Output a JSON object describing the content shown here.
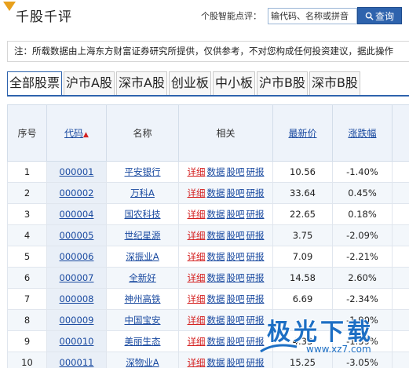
{
  "header": {
    "title": "千股千评",
    "search_label": "个股智能点评：",
    "search_placeholder": "输代码、名称或拼音",
    "search_button": "查询"
  },
  "notice": "注：所载数据由上海东方财富证券研究所提供，仅供参考，不对您构成任何投资建议，据此操作",
  "tabs": [
    "全部股票",
    "沪市A股",
    "深市A股",
    "创业板",
    "中小板",
    "沪市B股",
    "深市B股"
  ],
  "table": {
    "columns": {
      "seq": "序号",
      "code": "代码",
      "name": "名称",
      "related": "相关",
      "price": "最新价",
      "change": "涨跌幅"
    },
    "related_links": [
      "详细",
      "数据",
      "股吧",
      "研报"
    ],
    "rows": [
      {
        "seq": "1",
        "code": "000001",
        "name": "平安银行",
        "price": "10.56",
        "change": "-1.40%",
        "dir": "down"
      },
      {
        "seq": "2",
        "code": "000002",
        "name": "万科A",
        "price": "33.64",
        "change": "0.45%",
        "dir": "up"
      },
      {
        "seq": "3",
        "code": "000004",
        "name": "国农科技",
        "price": "22.65",
        "change": "0.18%",
        "dir": "up"
      },
      {
        "seq": "4",
        "code": "000005",
        "name": "世纪星源",
        "price": "3.75",
        "change": "-2.09%",
        "dir": "down"
      },
      {
        "seq": "5",
        "code": "000006",
        "name": "深振业A",
        "price": "7.09",
        "change": "-2.21%",
        "dir": "down"
      },
      {
        "seq": "6",
        "code": "000007",
        "name": "全新好",
        "price": "14.58",
        "change": "2.60%",
        "dir": "up"
      },
      {
        "seq": "7",
        "code": "000008",
        "name": "神州高铁",
        "price": "6.69",
        "change": "-2.34%",
        "dir": "down"
      },
      {
        "seq": "8",
        "code": "000009",
        "name": "中国宝安",
        "price": "",
        "change": "-1.90%",
        "dir": "down"
      },
      {
        "seq": "9",
        "code": "000010",
        "name": "美丽生态",
        "price": "4.33",
        "change": "-1.59%",
        "dir": "down"
      },
      {
        "seq": "10",
        "code": "000011",
        "name": "深物业A",
        "price": "15.25",
        "change": "-3.05%",
        "dir": "down"
      }
    ]
  },
  "watermark": {
    "title": "极光下载",
    "url": "www.xz7.com"
  },
  "colors": {
    "accent": "#2e63ad",
    "up": "#d42020",
    "down": "#1a9a1a",
    "link": "#1a4aa0"
  }
}
